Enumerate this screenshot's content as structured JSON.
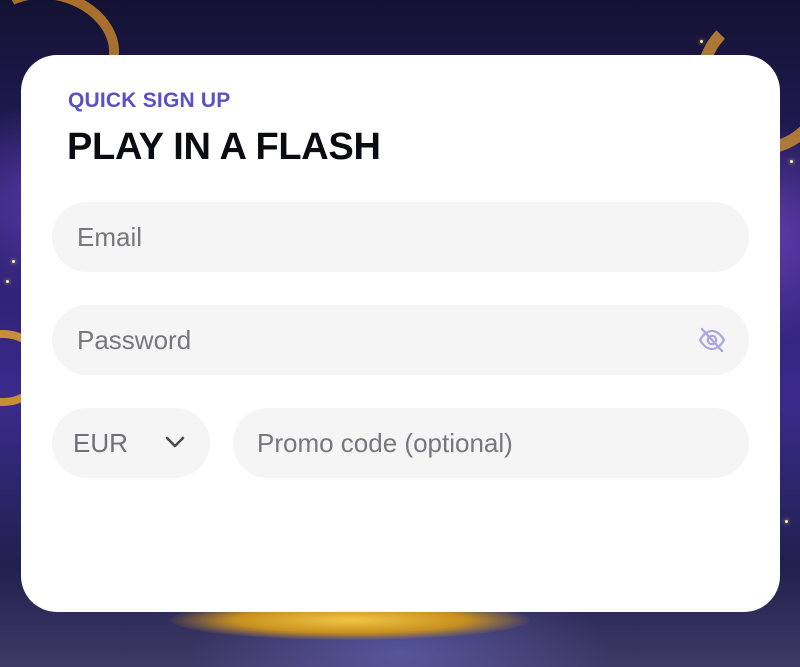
{
  "signup": {
    "eyebrow": "QUICK SIGN UP",
    "headline": "PLAY IN A FLASH"
  },
  "fields": {
    "email_placeholder": "Email",
    "email_value": "",
    "password_placeholder": "Password",
    "password_value": "",
    "password_toggle_icon": "eye-off-icon",
    "currency_selected": "EUR",
    "currency_icon": "chevron-down-icon",
    "promo_placeholder": "Promo code (optional)",
    "promo_value": ""
  },
  "colors": {
    "eyebrow": "#5a52c4",
    "headline": "#0b0b12",
    "field_bg": "#f5f5f6",
    "card_bg": "#ffffff",
    "icon": "#a9a6e0"
  }
}
